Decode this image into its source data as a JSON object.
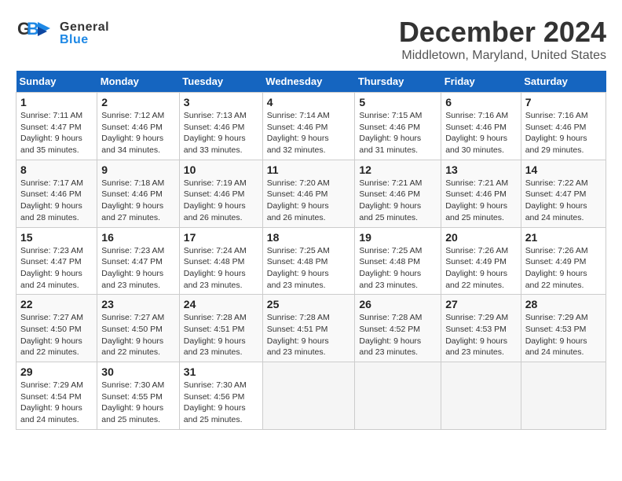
{
  "header": {
    "logo_general": "General",
    "logo_blue": "Blue",
    "month": "December 2024",
    "location": "Middletown, Maryland, United States"
  },
  "calendar": {
    "days_of_week": [
      "Sunday",
      "Monday",
      "Tuesday",
      "Wednesday",
      "Thursday",
      "Friday",
      "Saturday"
    ],
    "weeks": [
      [
        {
          "day": "1",
          "sunrise": "7:11 AM",
          "sunset": "4:47 PM",
          "daylight": "9 hours and 35 minutes."
        },
        {
          "day": "2",
          "sunrise": "7:12 AM",
          "sunset": "4:46 PM",
          "daylight": "9 hours and 34 minutes."
        },
        {
          "day": "3",
          "sunrise": "7:13 AM",
          "sunset": "4:46 PM",
          "daylight": "9 hours and 33 minutes."
        },
        {
          "day": "4",
          "sunrise": "7:14 AM",
          "sunset": "4:46 PM",
          "daylight": "9 hours and 32 minutes."
        },
        {
          "day": "5",
          "sunrise": "7:15 AM",
          "sunset": "4:46 PM",
          "daylight": "9 hours and 31 minutes."
        },
        {
          "day": "6",
          "sunrise": "7:16 AM",
          "sunset": "4:46 PM",
          "daylight": "9 hours and 30 minutes."
        },
        {
          "day": "7",
          "sunrise": "7:16 AM",
          "sunset": "4:46 PM",
          "daylight": "9 hours and 29 minutes."
        }
      ],
      [
        {
          "day": "8",
          "sunrise": "7:17 AM",
          "sunset": "4:46 PM",
          "daylight": "9 hours and 28 minutes."
        },
        {
          "day": "9",
          "sunrise": "7:18 AM",
          "sunset": "4:46 PM",
          "daylight": "9 hours and 27 minutes."
        },
        {
          "day": "10",
          "sunrise": "7:19 AM",
          "sunset": "4:46 PM",
          "daylight": "9 hours and 26 minutes."
        },
        {
          "day": "11",
          "sunrise": "7:20 AM",
          "sunset": "4:46 PM",
          "daylight": "9 hours and 26 minutes."
        },
        {
          "day": "12",
          "sunrise": "7:21 AM",
          "sunset": "4:46 PM",
          "daylight": "9 hours and 25 minutes."
        },
        {
          "day": "13",
          "sunrise": "7:21 AM",
          "sunset": "4:46 PM",
          "daylight": "9 hours and 25 minutes."
        },
        {
          "day": "14",
          "sunrise": "7:22 AM",
          "sunset": "4:47 PM",
          "daylight": "9 hours and 24 minutes."
        }
      ],
      [
        {
          "day": "15",
          "sunrise": "7:23 AM",
          "sunset": "4:47 PM",
          "daylight": "9 hours and 24 minutes."
        },
        {
          "day": "16",
          "sunrise": "7:23 AM",
          "sunset": "4:47 PM",
          "daylight": "9 hours and 23 minutes."
        },
        {
          "day": "17",
          "sunrise": "7:24 AM",
          "sunset": "4:48 PM",
          "daylight": "9 hours and 23 minutes."
        },
        {
          "day": "18",
          "sunrise": "7:25 AM",
          "sunset": "4:48 PM",
          "daylight": "9 hours and 23 minutes."
        },
        {
          "day": "19",
          "sunrise": "7:25 AM",
          "sunset": "4:48 PM",
          "daylight": "9 hours and 23 minutes."
        },
        {
          "day": "20",
          "sunrise": "7:26 AM",
          "sunset": "4:49 PM",
          "daylight": "9 hours and 22 minutes."
        },
        {
          "day": "21",
          "sunrise": "7:26 AM",
          "sunset": "4:49 PM",
          "daylight": "9 hours and 22 minutes."
        }
      ],
      [
        {
          "day": "22",
          "sunrise": "7:27 AM",
          "sunset": "4:50 PM",
          "daylight": "9 hours and 22 minutes."
        },
        {
          "day": "23",
          "sunrise": "7:27 AM",
          "sunset": "4:50 PM",
          "daylight": "9 hours and 22 minutes."
        },
        {
          "day": "24",
          "sunrise": "7:28 AM",
          "sunset": "4:51 PM",
          "daylight": "9 hours and 23 minutes."
        },
        {
          "day": "25",
          "sunrise": "7:28 AM",
          "sunset": "4:51 PM",
          "daylight": "9 hours and 23 minutes."
        },
        {
          "day": "26",
          "sunrise": "7:28 AM",
          "sunset": "4:52 PM",
          "daylight": "9 hours and 23 minutes."
        },
        {
          "day": "27",
          "sunrise": "7:29 AM",
          "sunset": "4:53 PM",
          "daylight": "9 hours and 23 minutes."
        },
        {
          "day": "28",
          "sunrise": "7:29 AM",
          "sunset": "4:53 PM",
          "daylight": "9 hours and 24 minutes."
        }
      ],
      [
        {
          "day": "29",
          "sunrise": "7:29 AM",
          "sunset": "4:54 PM",
          "daylight": "9 hours and 24 minutes."
        },
        {
          "day": "30",
          "sunrise": "7:30 AM",
          "sunset": "4:55 PM",
          "daylight": "9 hours and 25 minutes."
        },
        {
          "day": "31",
          "sunrise": "7:30 AM",
          "sunset": "4:56 PM",
          "daylight": "9 hours and 25 minutes."
        },
        null,
        null,
        null,
        null
      ]
    ]
  }
}
